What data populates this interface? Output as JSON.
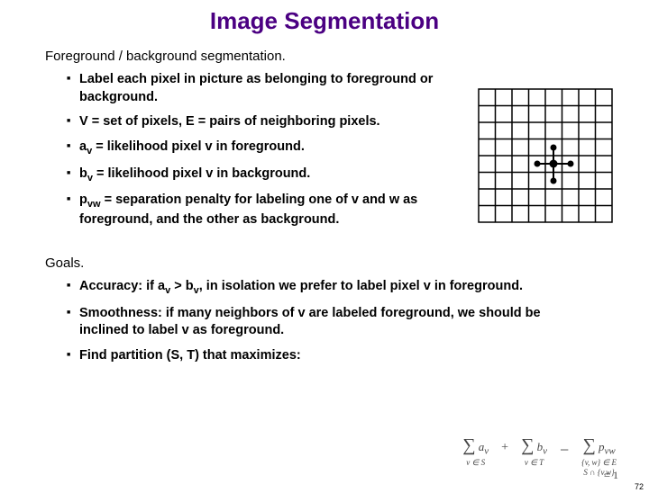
{
  "title": "Image Segmentation",
  "section1": "Foreground / background segmentation.",
  "bullets1": {
    "b0": "Label each pixel in picture as belonging to foreground or background.",
    "b1": "V = set of pixels, E = pairs of neighboring pixels.",
    "b2a": "a",
    "b2s": "v",
    "b2b": " = likelihood pixel v in foreground.",
    "b3a": "b",
    "b3s": "v",
    "b3b": " = likelihood pixel v in background.",
    "b4a": "p",
    "b4s": "vw",
    "b4b": " = separation penalty for labeling one of v and w as foreground, and the other as background."
  },
  "section2": "Goals.",
  "bullets2": {
    "g0a": "Accuracy:  if a",
    "g0s1": "v",
    "g0b": " > b",
    "g0s2": "v",
    "g0c": ", in isolation we prefer to label pixel v in foreground.",
    "g1": "Smoothness: if many neighbors of v are labeled foreground, we should be inclined to label v as foreground.",
    "g2": "Find partition (S, T) that maximizes:"
  },
  "formula": {
    "sum1_top": "a",
    "sum1_sub": "v",
    "sum1_under": "v ∈ S",
    "plus": "+",
    "sum2_top": "b",
    "sum2_sub": "v",
    "sum2_under": "v ∈ T",
    "minus": "−",
    "sum3_top": "p",
    "sum3_sub": "vw",
    "sum3_u1": "{v, w} ∈ E",
    "sum3_u2": "S ∩ {v,w}",
    "eq1": "= 1"
  },
  "page": "72"
}
